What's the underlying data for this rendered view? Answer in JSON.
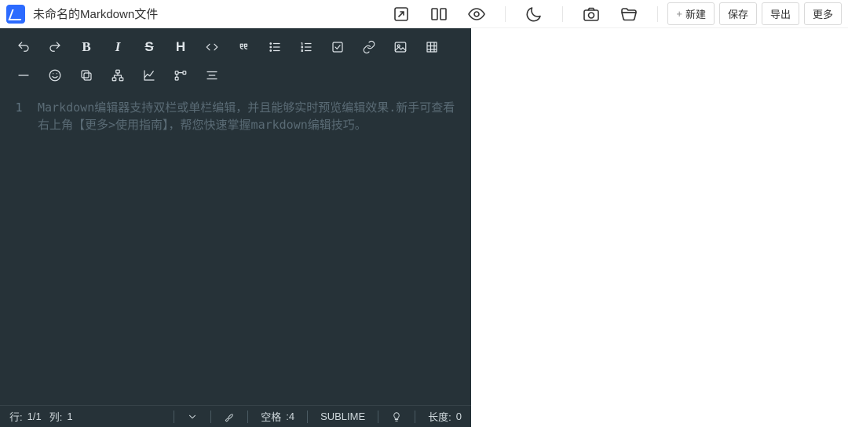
{
  "header": {
    "title": "未命名的Markdown文件",
    "buttons": {
      "new": "新建",
      "save": "保存",
      "export": "导出",
      "more": "更多"
    }
  },
  "editor": {
    "line_numbers": [
      "1"
    ],
    "placeholder": "Markdown编辑器支持双栏或单栏编辑，并且能够实时预览编辑效果.新手可查看右上角【更多>使用指南】，帮您快速掌握markdown编辑技巧。"
  },
  "statusbar": {
    "row_label": "行:",
    "row_value": "1/1",
    "col_label": "列:",
    "col_value": "1",
    "space_label": "空格",
    "space_value": ":4",
    "mode": "SUBLIME",
    "len_label": "长度:",
    "len_value": "0"
  },
  "toolbar": {
    "row1": [
      "undo",
      "redo",
      "bold",
      "italic",
      "strike",
      "heading",
      "code",
      "quote",
      "ul",
      "ol",
      "task",
      "link",
      "image"
    ],
    "row2": [
      "table",
      "hr",
      "emoji",
      "copy",
      "sitemap",
      "chart",
      "flow",
      "align"
    ]
  }
}
